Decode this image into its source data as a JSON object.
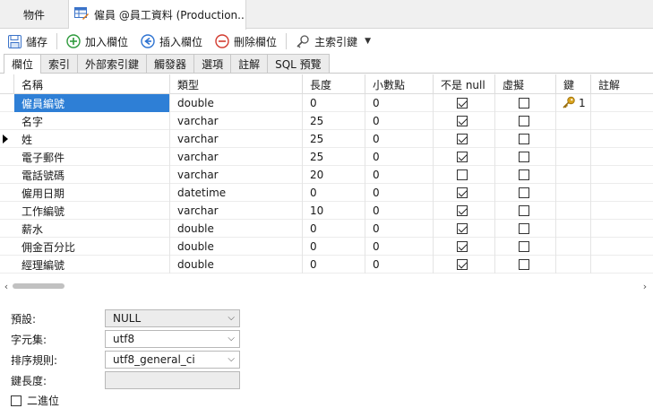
{
  "doc_tabs": {
    "objects_label": "物件",
    "active_label": "僱員 @員工資料 (Production..."
  },
  "toolbar": {
    "save": "儲存",
    "add_field": "加入欄位",
    "insert_field": "插入欄位",
    "delete_field": "刪除欄位",
    "primary_key": "主索引鍵"
  },
  "sub_tabs": [
    "欄位",
    "索引",
    "外部索引鍵",
    "觸發器",
    "選項",
    "註解",
    "SQL 預覽"
  ],
  "columns": {
    "name": "名稱",
    "type": "類型",
    "length": "長度",
    "decimals": "小數點",
    "not_null": "不是 null",
    "virtual": "虛擬",
    "key": "鍵",
    "comment": "註解"
  },
  "rows": [
    {
      "name": "僱員編號",
      "type": "double",
      "length": "0",
      "decimals": "0",
      "not_null": true,
      "virtual": false,
      "key": "1"
    },
    {
      "name": "名字",
      "type": "varchar",
      "length": "25",
      "decimals": "0",
      "not_null": true,
      "virtual": false,
      "key": ""
    },
    {
      "name": "姓",
      "type": "varchar",
      "length": "25",
      "decimals": "0",
      "not_null": true,
      "virtual": false,
      "key": ""
    },
    {
      "name": "電子郵件",
      "type": "varchar",
      "length": "25",
      "decimals": "0",
      "not_null": true,
      "virtual": false,
      "key": ""
    },
    {
      "name": "電話號碼",
      "type": "varchar",
      "length": "20",
      "decimals": "0",
      "not_null": false,
      "virtual": false,
      "key": ""
    },
    {
      "name": "僱用日期",
      "type": "datetime",
      "length": "0",
      "decimals": "0",
      "not_null": true,
      "virtual": false,
      "key": ""
    },
    {
      "name": "工作編號",
      "type": "varchar",
      "length": "10",
      "decimals": "0",
      "not_null": true,
      "virtual": false,
      "key": ""
    },
    {
      "name": "薪水",
      "type": "double",
      "length": "0",
      "decimals": "0",
      "not_null": true,
      "virtual": false,
      "key": ""
    },
    {
      "name": "佣金百分比",
      "type": "double",
      "length": "0",
      "decimals": "0",
      "not_null": true,
      "virtual": false,
      "key": ""
    },
    {
      "name": "經理編號",
      "type": "double",
      "length": "0",
      "decimals": "0",
      "not_null": true,
      "virtual": false,
      "key": ""
    }
  ],
  "props": {
    "default_label": "預設:",
    "default_value": "NULL",
    "charset_label": "字元集:",
    "charset_value": "utf8",
    "collation_label": "排序規則:",
    "collation_value": "utf8_general_ci",
    "key_length_label": "鍵長度:",
    "key_length_value": "",
    "binary_label": "二進位"
  },
  "colors": {
    "selection": "#2e7fd6",
    "key_icon": "#d9a21b"
  }
}
